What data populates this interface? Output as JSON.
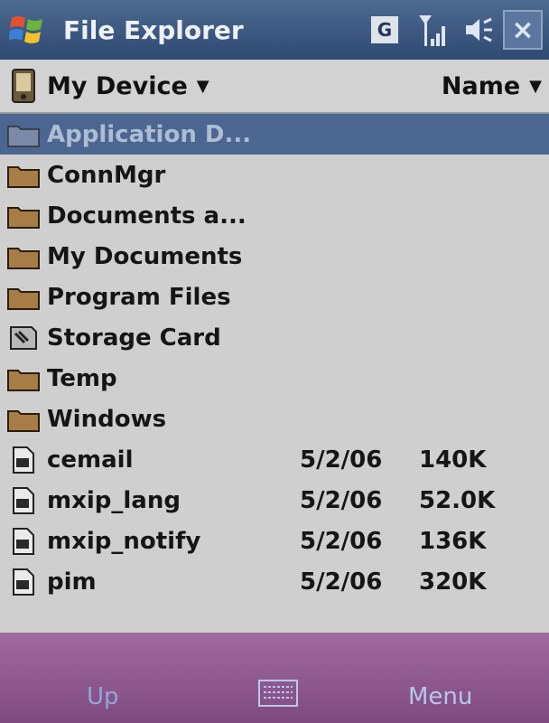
{
  "titlebar": {
    "title": "File Explorer",
    "icons": [
      "windows-start-icon",
      "g-icon",
      "signal-icon",
      "speaker-icon",
      "close-icon"
    ],
    "g_label": "G",
    "close_label": "×"
  },
  "locbar": {
    "location": "My Device",
    "sort": "Name"
  },
  "items": [
    {
      "name": "Application D...",
      "type": "folder-system",
      "date": "",
      "size": "",
      "selected": true
    },
    {
      "name": "ConnMgr",
      "type": "folder",
      "date": "",
      "size": ""
    },
    {
      "name": "Documents a...",
      "type": "folder",
      "date": "",
      "size": ""
    },
    {
      "name": "My Documents",
      "type": "folder",
      "date": "",
      "size": ""
    },
    {
      "name": "Program Files",
      "type": "folder",
      "date": "",
      "size": ""
    },
    {
      "name": "Storage Card",
      "type": "storage-card",
      "date": "",
      "size": ""
    },
    {
      "name": "Temp",
      "type": "folder",
      "date": "",
      "size": ""
    },
    {
      "name": "Windows",
      "type": "folder",
      "date": "",
      "size": ""
    },
    {
      "name": "cemail",
      "type": "file",
      "date": "5/2/06",
      "size": "140K"
    },
    {
      "name": "mxip_lang",
      "type": "file",
      "date": "5/2/06",
      "size": "52.0K"
    },
    {
      "name": "mxip_notify",
      "type": "file",
      "date": "5/2/06",
      "size": "136K"
    },
    {
      "name": "pim",
      "type": "file",
      "date": "5/2/06",
      "size": "320K"
    }
  ],
  "softkeys": {
    "left": "Up",
    "right": "Menu"
  },
  "colors": {
    "titlebar": "#2f4a72",
    "selection": "#4a6691",
    "softbar": "#8f5a90"
  }
}
